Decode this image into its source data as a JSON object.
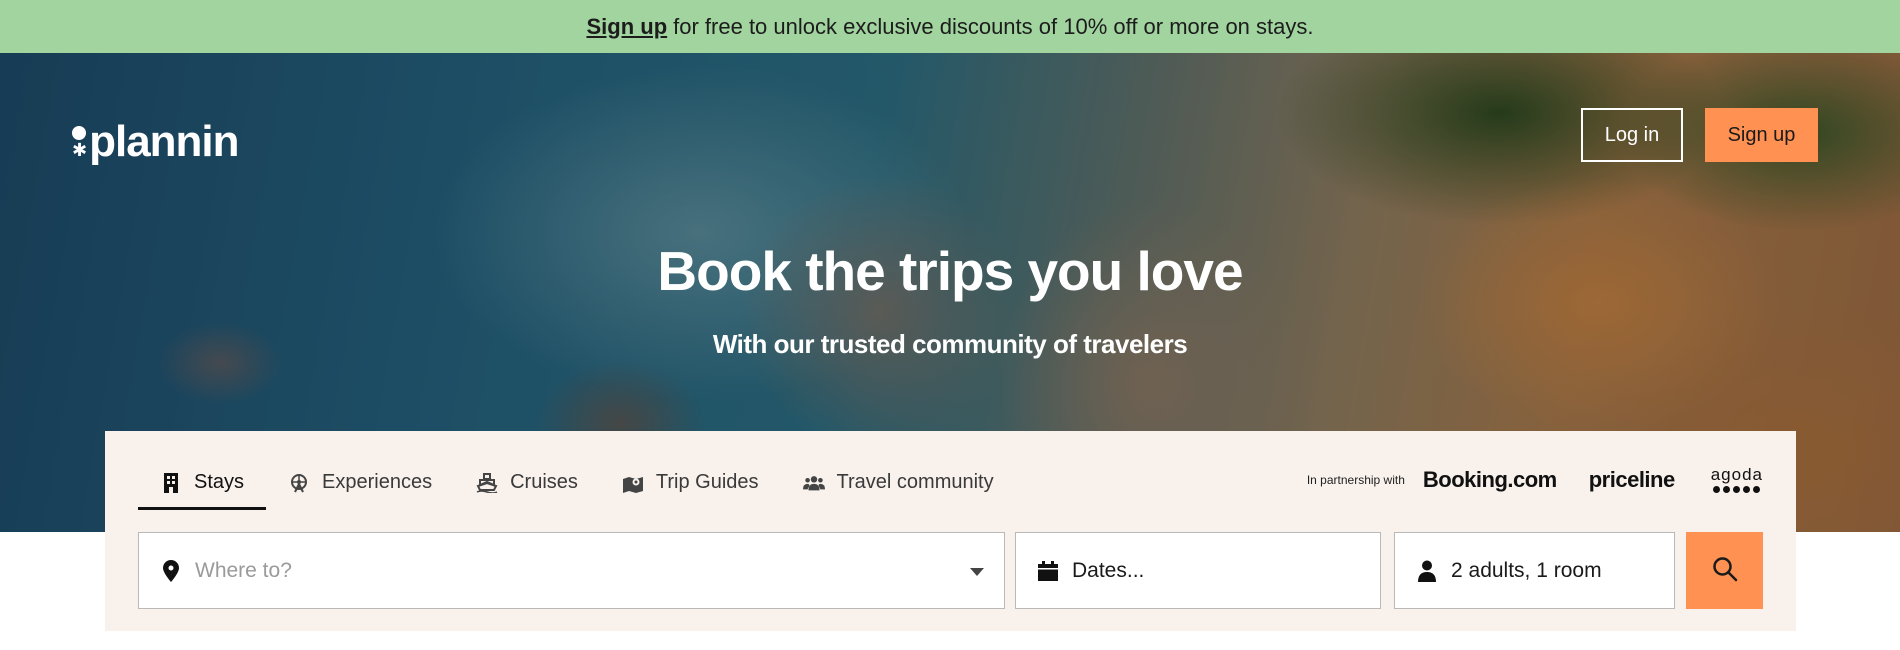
{
  "banner": {
    "link_text": "Sign up",
    "text": "for free to unlock exclusive discounts of 10% off or more on stays."
  },
  "header": {
    "logo_text": "plannin",
    "login_label": "Log in",
    "signup_label": "Sign up"
  },
  "hero": {
    "title": "Book the trips you love",
    "subtitle": "With our trusted community of travelers"
  },
  "tabs": [
    {
      "label": "Stays",
      "icon": "hotel-building-icon",
      "active": true
    },
    {
      "label": "Experiences",
      "icon": "ferris-wheel-icon",
      "active": false
    },
    {
      "label": "Cruises",
      "icon": "ship-icon",
      "active": false
    },
    {
      "label": "Trip Guides",
      "icon": "map-pin-icon",
      "active": false
    },
    {
      "label": "Travel community",
      "icon": "users-icon",
      "active": false
    }
  ],
  "partners": {
    "label": "In partnership with",
    "items": [
      "Booking.com",
      "priceline",
      "agoda"
    ]
  },
  "search": {
    "where_placeholder": "Where to?",
    "dates_placeholder": "Dates...",
    "guests_value": "2 adults, 1 room"
  },
  "colors": {
    "banner": "#a1d49f",
    "accent": "#ff9153",
    "panel": "#f8f1ec"
  }
}
